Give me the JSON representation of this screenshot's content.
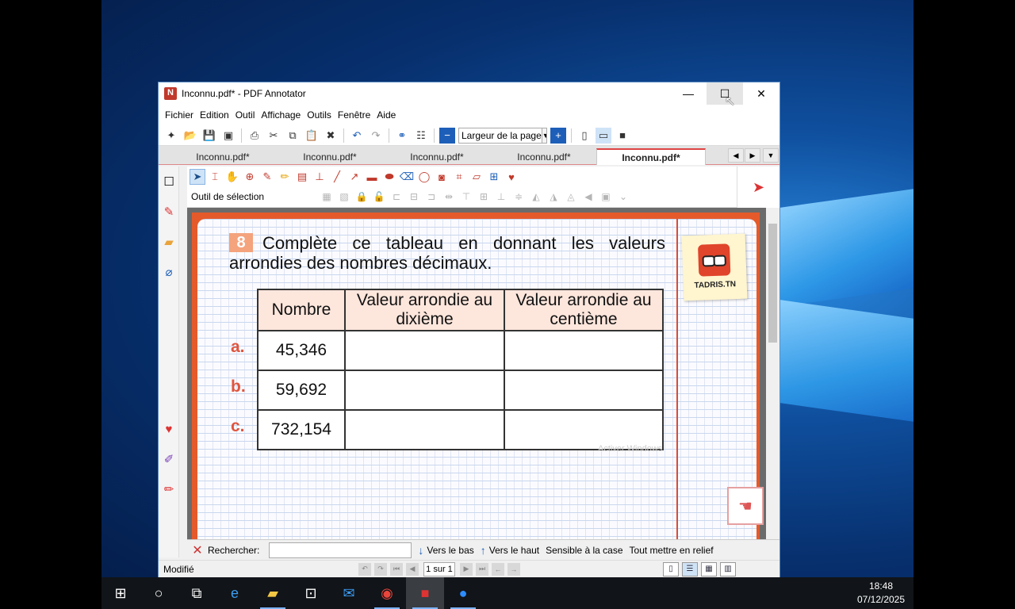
{
  "window": {
    "title": "Inconnu.pdf* - PDF Annotator",
    "minimize": "—",
    "maximize": "☐",
    "close": "✕"
  },
  "menu": [
    "Fichier",
    "Edition",
    "Outil",
    "Affichage",
    "Outils",
    "Fenêtre",
    "Aide"
  ],
  "toolbar": {
    "zoom_value": "Largeur de la page"
  },
  "tabs": [
    "Inconnu.pdf*",
    "Inconnu.pdf*",
    "Inconnu.pdf*",
    "Inconnu.pdf*",
    "Inconnu.pdf*"
  ],
  "active_tab_index": 4,
  "annotation": {
    "tool_label": "Outil de sélection"
  },
  "document": {
    "exercise_number": "8",
    "exercise_title": "Complète ce tableau en donnant les valeurs arrondies des nombres décimaux.",
    "table_headers": [
      "Nombre",
      "Valeur arrondie au dixième",
      "Valeur arrondie au centième"
    ],
    "rows": [
      {
        "letter": "a.",
        "number": "45,346",
        "tenth": "",
        "hundredth": ""
      },
      {
        "letter": "b.",
        "number": "59,692",
        "tenth": "",
        "hundredth": ""
      },
      {
        "letter": "c.",
        "number": "732,154",
        "tenth": "",
        "hundredth": ""
      }
    ],
    "sticker_text": "TADRIS.TN",
    "watermark": "Activer Windows"
  },
  "search": {
    "label": "Rechercher:",
    "value": "",
    "down_label": "Vers le bas",
    "up_label": "Vers le haut",
    "case_label": "Sensible à la case",
    "highlight_label": "Tout mettre en relief"
  },
  "status": {
    "text": "Modifié",
    "page_indicator": "1 sur 1"
  },
  "taskbar": {
    "time": "18:48",
    "date": "07/12/2025"
  },
  "colors": {
    "accent": "#c0392b",
    "page_border": "#e55a2b",
    "header_fill": "#fde6dc",
    "letter_color": "#e0553f"
  }
}
